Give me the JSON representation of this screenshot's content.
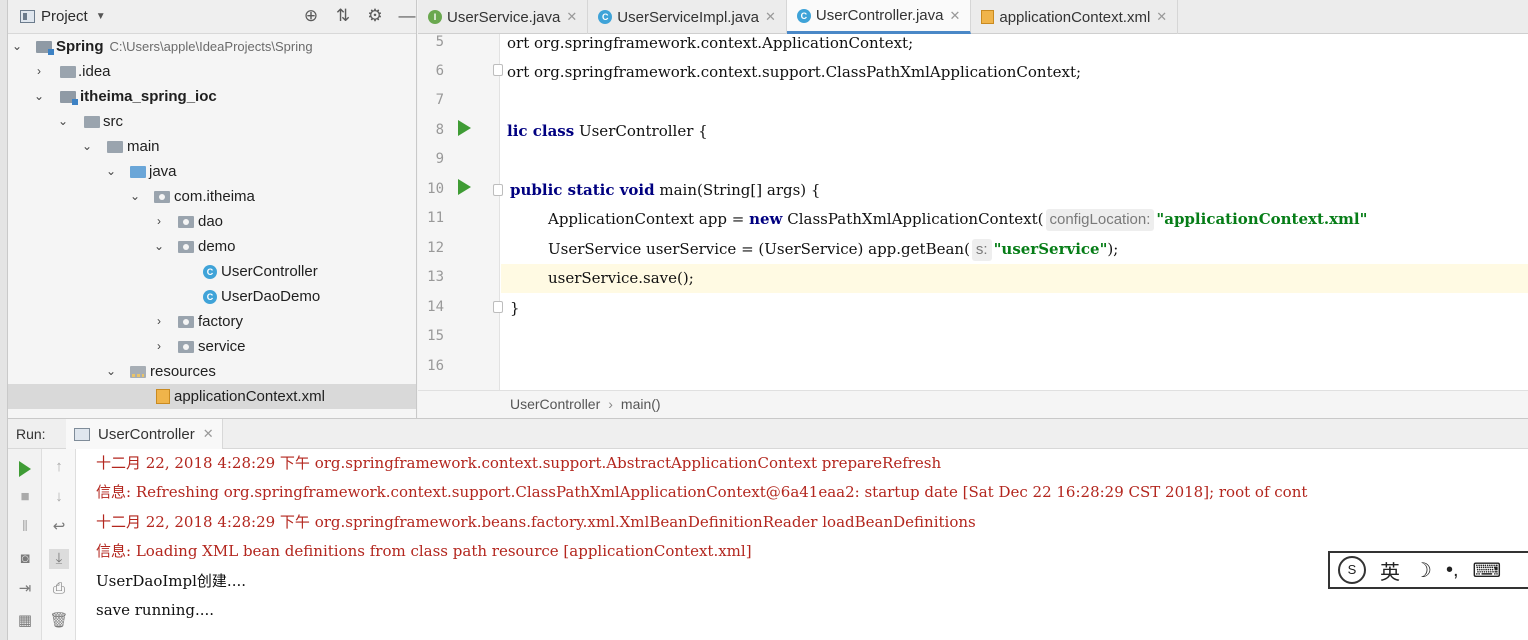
{
  "project": {
    "title": "Project",
    "tree": [
      {
        "label": "Spring",
        "hint": "C:\\Users\\apple\\IdeaProjects\\Spring"
      },
      {
        "label": ".idea"
      },
      {
        "label": "itheima_spring_ioc"
      },
      {
        "label": "src"
      },
      {
        "label": "main"
      },
      {
        "label": "java"
      },
      {
        "label": "com.itheima"
      },
      {
        "label": "dao"
      },
      {
        "label": "demo"
      },
      {
        "label": "UserController"
      },
      {
        "label": "UserDaoDemo"
      },
      {
        "label": "factory"
      },
      {
        "label": "service"
      },
      {
        "label": "resources"
      },
      {
        "label": "applicationContext.xml"
      }
    ]
  },
  "editor": {
    "tabs": [
      {
        "label": "UserService.java"
      },
      {
        "label": "UserServiceImpl.java"
      },
      {
        "label": "UserController.java"
      },
      {
        "label": "applicationContext.xml"
      }
    ],
    "line_numbers": [
      "5",
      "6",
      "7",
      "8",
      "9",
      "10",
      "11",
      "12",
      "13",
      "14",
      "15",
      "16"
    ],
    "code": {
      "l5": "ort org.springframework.context.ApplicationContext;",
      "l6": "ort org.springframework.context.support.ClassPathXmlApplicationContext;",
      "l8_kw": "lic class",
      "l8_rest": " UserController {",
      "l10_kw": "public static void",
      "l10_rest": " main(String[] args) {",
      "l11_a": "ApplicationContext app = ",
      "l11_kw": "new",
      "l11_b": " ClassPathXmlApplicationContext(",
      "l11_hint": "configLocation:",
      "l11_str": "\"applicationContext.xml\"",
      "l12_a": "UserService userService = (UserService) app.getBean(",
      "l12_hint": "s:",
      "l12_str": "\"userService\"",
      "l12_b": ");",
      "l13": "userService.save();",
      "l14": "}"
    },
    "breadcrumb": [
      "UserController",
      "main()"
    ]
  },
  "run": {
    "label": "Run:",
    "tab": "UserController",
    "console": [
      "十二月 22, 2018 4:28:29 下午 org.springframework.context.support.AbstractApplicationContext prepareRefresh",
      "信息: Refreshing org.springframework.context.support.ClassPathXmlApplicationContext@6a41eaa2: startup date [Sat Dec 22 16:28:29 CST 2018]; root of cont",
      "十二月 22, 2018 4:28:29 下午 org.springframework.beans.factory.xml.XmlBeanDefinitionReader loadBeanDefinitions",
      "信息: Loading XML bean definitions from class path resource [applicationContext.xml]",
      "UserDaoImpl创建....",
      "save running...."
    ]
  },
  "ime": {
    "lang": "英"
  }
}
